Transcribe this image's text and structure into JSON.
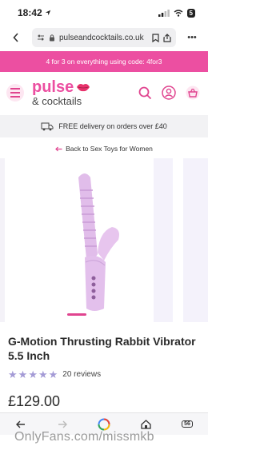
{
  "status": {
    "time": "18:42",
    "battery": "5"
  },
  "browser": {
    "url": "pulseandcocktails.co.uk",
    "more": "•••"
  },
  "promo": {
    "text": "4 for 3 on everything using code: 4for3"
  },
  "logo": {
    "main": "pulse",
    "sub": "& cocktails"
  },
  "delivery": {
    "text": "FREE delivery on orders over £40"
  },
  "back_link": {
    "text": "Back to Sex Toys for Women"
  },
  "product": {
    "title": "G-Motion Thrusting Rabbit Vibrator 5.5 Inch",
    "rating_stars": 5,
    "reviews": "20 reviews",
    "price": "£129.00"
  },
  "toolbar": {
    "tab_count": "56"
  },
  "watermark": {
    "text": "OnlyFans.com/missmkb"
  },
  "colors": {
    "brand_pink": "#ec4fa1",
    "star_color": "#a49bd6",
    "product_lilac": "#e3c0ec"
  }
}
